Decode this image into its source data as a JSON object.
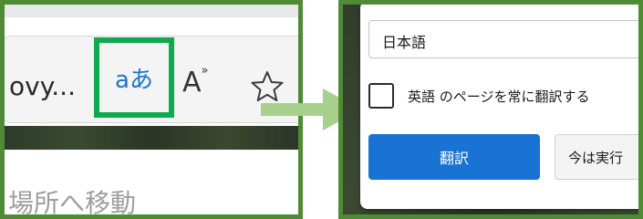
{
  "left_panel": {
    "address_text": "ovy...",
    "translate_icon_glyph": "aあ",
    "read_aloud_glyph": "A",
    "read_aloud_waves": "»",
    "bottom_text": "場所へ移動",
    "icons": [
      "translate-icon",
      "read-aloud-icon",
      "favorite-star-icon"
    ],
    "highlight_color": "#0fa94f"
  },
  "right_panel": {
    "language_select_value": "日本語",
    "checkbox_label": "英語 のページを常に翻訳する",
    "translate_button_label": "翻訳",
    "not_now_button_label": "今は実行",
    "accent_color": "#1873d3"
  },
  "frame_color": "#4f8a34",
  "arrow_color": "#a8d08d"
}
